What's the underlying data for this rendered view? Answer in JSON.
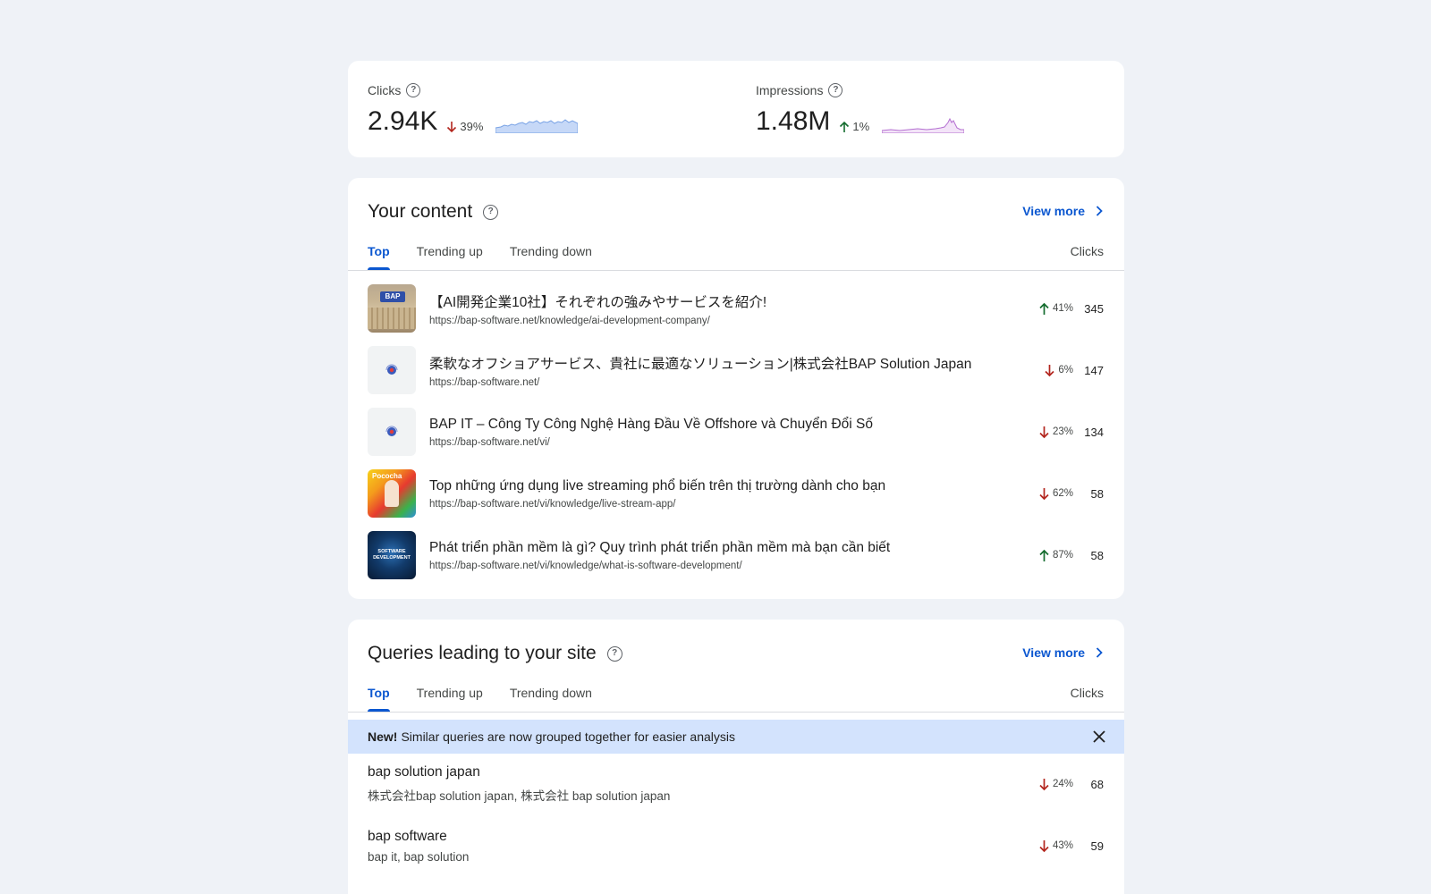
{
  "metrics": {
    "clicks": {
      "label": "Clicks",
      "value": "2.94K",
      "delta": "39%",
      "direction": "down"
    },
    "impressions": {
      "label": "Impressions",
      "value": "1.48M",
      "delta": "1%",
      "direction": "up"
    }
  },
  "content": {
    "title": "Your content",
    "view_more": "View more",
    "tabs": [
      "Top",
      "Trending up",
      "Trending down"
    ],
    "column": "Clicks",
    "rows": [
      {
        "title": "【AI開発企業10社】それぞれの強みやサービスを紹介!",
        "url": "https://bap-software.net/knowledge/ai-development-company/",
        "delta": "41%",
        "direction": "up",
        "clicks": "345"
      },
      {
        "title": "柔軟なオフショアサービス、貴社に最適なソリューション|株式会社BAP Solution Japan",
        "url": "https://bap-software.net/",
        "delta": "6%",
        "direction": "down",
        "clicks": "147"
      },
      {
        "title": "BAP IT – Công Ty Công Nghệ Hàng Đầu Về Offshore và Chuyển Đổi Số",
        "url": "https://bap-software.net/vi/",
        "delta": "23%",
        "direction": "down",
        "clicks": "134"
      },
      {
        "title": "Top những ứng dụng live streaming phổ biến trên thị trường dành cho bạn",
        "url": "https://bap-software.net/vi/knowledge/live-stream-app/",
        "delta": "62%",
        "direction": "down",
        "clicks": "58"
      },
      {
        "title": "Phát triển phần mềm là gì? Quy trình phát triển phần mềm mà bạn cần biết",
        "url": "https://bap-software.net/vi/knowledge/what-is-software-development/",
        "delta": "87%",
        "direction": "up",
        "clicks": "58"
      }
    ]
  },
  "queries": {
    "title": "Queries leading to your site",
    "view_more": "View more",
    "tabs": [
      "Top",
      "Trending up",
      "Trending down"
    ],
    "column": "Clicks",
    "banner": {
      "bold": "New!",
      "text": "Similar queries are now grouped together for easier analysis"
    },
    "rows": [
      {
        "title": "bap solution japan",
        "sub": "株式会社bap solution japan, 株式会社 bap solution japan",
        "delta": "24%",
        "direction": "down",
        "clicks": "68"
      },
      {
        "title": "bap software",
        "sub": "bap it, bap solution",
        "delta": "43%",
        "direction": "down",
        "clicks": "59"
      }
    ]
  },
  "colors": {
    "accent": "#0b57d0",
    "down": "#b3261e",
    "up": "#146c2e",
    "banner": "#d3e3fd"
  }
}
